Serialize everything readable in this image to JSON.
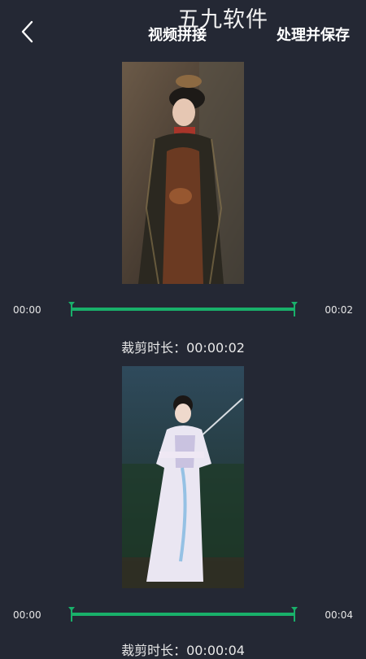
{
  "header": {
    "watermark": "五九软件",
    "title": "视频拼接",
    "save_label": "处理并保存",
    "back_icon": "chevron-left-icon"
  },
  "colors": {
    "background": "#242834",
    "accent": "#19b06a",
    "text": "#ffffff"
  },
  "clips": [
    {
      "start_time": "00:00",
      "end_time": "00:02",
      "duration_label": "裁剪时长：00:00:02",
      "trim_start_fraction": 0,
      "trim_end_fraction": 1
    },
    {
      "start_time": "00:00",
      "end_time": "00:04",
      "duration_label": "裁剪时长：00:00:04",
      "trim_start_fraction": 0,
      "trim_end_fraction": 1
    }
  ]
}
